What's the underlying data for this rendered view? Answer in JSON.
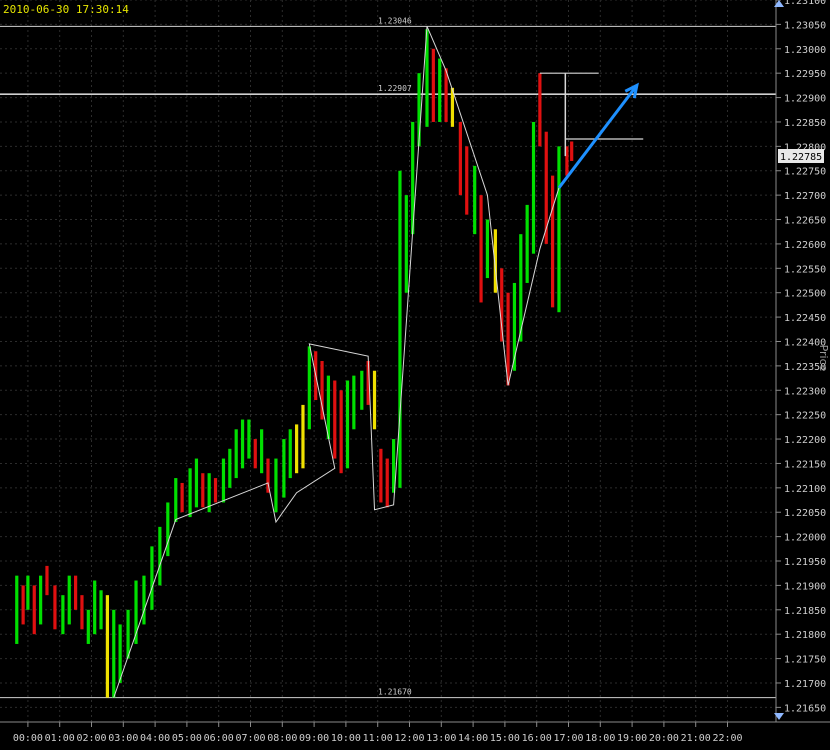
{
  "timestamp": "2010-06-30 17:30:14",
  "axis_title": "Price",
  "colors": {
    "background": "#000000",
    "grid": "#2c2c2c",
    "bar_up": "#00e000",
    "bar_down": "#e01010",
    "bar_neutral": "#f0e000",
    "zigzag": "#d8d8d8",
    "ref_line": "#d0d0d0",
    "arrow": "#1e90ff",
    "text": "#cfcfcf",
    "timestamp": "#e6e600"
  },
  "icons": {
    "scroll_up": "triangle-up-icon",
    "scroll_down": "triangle-down-icon"
  },
  "chart_data": {
    "type": "bar",
    "style": "ohlc-bars",
    "ylim": [
      1.2162,
      1.231
    ],
    "x_range": [
      0,
      23
    ],
    "grid": true,
    "y_ticks": [
      "1.23100",
      "1.23050",
      "1.23000",
      "1.22950",
      "1.22900",
      "1.22850",
      "1.22800",
      "1.22750",
      "1.22700",
      "1.22650",
      "1.22600",
      "1.22550",
      "1.22500",
      "1.22450",
      "1.22400",
      "1.22350",
      "1.22300",
      "1.22250",
      "1.22200",
      "1.22150",
      "1.22100",
      "1.22050",
      "1.22000",
      "1.21950",
      "1.21900",
      "1.21850",
      "1.21800",
      "1.21750",
      "1.21700",
      "1.21650"
    ],
    "x_ticks": [
      "00:00",
      "01:00",
      "02:00",
      "03:00",
      "04:00",
      "05:00",
      "06:00",
      "07:00",
      "08:00",
      "09:00",
      "10:00",
      "11:00",
      "12:00",
      "13:00",
      "14:00",
      "15:00",
      "16:00",
      "17:00",
      "18:00",
      "19:00",
      "20:00",
      "21:00",
      "22:00"
    ],
    "current_price": "1.22785",
    "reference_lines": [
      {
        "label": "1.23046",
        "value": 1.23046
      },
      {
        "label": "1.22907",
        "value": 1.22907
      },
      {
        "label": "1.21670",
        "value": 1.2167
      }
    ],
    "bars": [
      {
        "t": 0.0,
        "h": 1.2192,
        "l": 1.2178,
        "c": "g"
      },
      {
        "t": 0.2,
        "h": 1.219,
        "l": 1.2182,
        "c": "r"
      },
      {
        "t": 0.35,
        "h": 1.2192,
        "l": 1.2185,
        "c": "g"
      },
      {
        "t": 0.55,
        "h": 1.219,
        "l": 1.218,
        "c": "r"
      },
      {
        "t": 0.75,
        "h": 1.2192,
        "l": 1.2182,
        "c": "g"
      },
      {
        "t": 0.95,
        "h": 1.2194,
        "l": 1.2188,
        "c": "r"
      },
      {
        "t": 1.2,
        "h": 1.219,
        "l": 1.2181,
        "c": "r"
      },
      {
        "t": 1.45,
        "h": 1.2188,
        "l": 1.218,
        "c": "g"
      },
      {
        "t": 1.65,
        "h": 1.2192,
        "l": 1.2182,
        "c": "g"
      },
      {
        "t": 1.85,
        "h": 1.2192,
        "l": 1.2185,
        "c": "r"
      },
      {
        "t": 2.05,
        "h": 1.2188,
        "l": 1.2181,
        "c": "r"
      },
      {
        "t": 2.25,
        "h": 1.2185,
        "l": 1.2178,
        "c": "g"
      },
      {
        "t": 2.45,
        "h": 1.2191,
        "l": 1.218,
        "c": "g"
      },
      {
        "t": 2.65,
        "h": 1.2189,
        "l": 1.2181,
        "c": "g"
      },
      {
        "t": 2.85,
        "h": 1.2188,
        "l": 1.2167,
        "c": "y"
      },
      {
        "t": 3.05,
        "h": 1.2185,
        "l": 1.2167,
        "c": "g"
      },
      {
        "t": 3.25,
        "h": 1.2182,
        "l": 1.217,
        "c": "g"
      },
      {
        "t": 3.5,
        "h": 1.2185,
        "l": 1.2175,
        "c": "g"
      },
      {
        "t": 3.75,
        "h": 1.2191,
        "l": 1.2178,
        "c": "g"
      },
      {
        "t": 4.0,
        "h": 1.2192,
        "l": 1.2182,
        "c": "g"
      },
      {
        "t": 4.25,
        "h": 1.2198,
        "l": 1.2185,
        "c": "g"
      },
      {
        "t": 4.5,
        "h": 1.2202,
        "l": 1.219,
        "c": "g"
      },
      {
        "t": 4.75,
        "h": 1.2207,
        "l": 1.2196,
        "c": "g"
      },
      {
        "t": 5.0,
        "h": 1.2212,
        "l": 1.2203,
        "c": "g"
      },
      {
        "t": 5.2,
        "h": 1.2211,
        "l": 1.2205,
        "c": "r"
      },
      {
        "t": 5.45,
        "h": 1.2214,
        "l": 1.2204,
        "c": "g"
      },
      {
        "t": 5.65,
        "h": 1.2216,
        "l": 1.2206,
        "c": "g"
      },
      {
        "t": 5.85,
        "h": 1.2213,
        "l": 1.2206,
        "c": "r"
      },
      {
        "t": 6.05,
        "h": 1.2213,
        "l": 1.2205,
        "c": "g"
      },
      {
        "t": 6.25,
        "h": 1.2212,
        "l": 1.2207,
        "c": "r"
      },
      {
        "t": 6.5,
        "h": 1.2216,
        "l": 1.2207,
        "c": "g"
      },
      {
        "t": 6.7,
        "h": 1.2218,
        "l": 1.221,
        "c": "g"
      },
      {
        "t": 6.9,
        "h": 1.2222,
        "l": 1.2212,
        "c": "g"
      },
      {
        "t": 7.1,
        "h": 1.2224,
        "l": 1.2214,
        "c": "g"
      },
      {
        "t": 7.3,
        "h": 1.2224,
        "l": 1.2216,
        "c": "g"
      },
      {
        "t": 7.5,
        "h": 1.222,
        "l": 1.2214,
        "c": "r"
      },
      {
        "t": 7.7,
        "h": 1.2222,
        "l": 1.2213,
        "c": "g"
      },
      {
        "t": 7.9,
        "h": 1.2216,
        "l": 1.2209,
        "c": "r"
      },
      {
        "t": 8.15,
        "h": 1.2216,
        "l": 1.2205,
        "c": "g"
      },
      {
        "t": 8.4,
        "h": 1.222,
        "l": 1.2208,
        "c": "g"
      },
      {
        "t": 8.6,
        "h": 1.2222,
        "l": 1.2212,
        "c": "g"
      },
      {
        "t": 8.8,
        "h": 1.2223,
        "l": 1.2213,
        "c": "y"
      },
      {
        "t": 9.0,
        "h": 1.2227,
        "l": 1.2214,
        "c": "y"
      },
      {
        "t": 9.2,
        "h": 1.2239,
        "l": 1.2222,
        "c": "g"
      },
      {
        "t": 9.4,
        "h": 1.2238,
        "l": 1.2228,
        "c": "r"
      },
      {
        "t": 9.6,
        "h": 1.2236,
        "l": 1.2224,
        "c": "r"
      },
      {
        "t": 9.8,
        "h": 1.2233,
        "l": 1.222,
        "c": "g"
      },
      {
        "t": 10.0,
        "h": 1.2232,
        "l": 1.2216,
        "c": "r"
      },
      {
        "t": 10.2,
        "h": 1.223,
        "l": 1.2213,
        "c": "r"
      },
      {
        "t": 10.4,
        "h": 1.2232,
        "l": 1.2214,
        "c": "g"
      },
      {
        "t": 10.6,
        "h": 1.2233,
        "l": 1.2222,
        "c": "g"
      },
      {
        "t": 10.85,
        "h": 1.2234,
        "l": 1.2226,
        "c": "g"
      },
      {
        "t": 11.05,
        "h": 1.2236,
        "l": 1.2227,
        "c": "r"
      },
      {
        "t": 11.25,
        "h": 1.2234,
        "l": 1.2222,
        "c": "y"
      },
      {
        "t": 11.45,
        "h": 1.2218,
        "l": 1.2207,
        "c": "r"
      },
      {
        "t": 11.65,
        "h": 1.2216,
        "l": 1.2206,
        "c": "r"
      },
      {
        "t": 11.85,
        "h": 1.222,
        "l": 1.2209,
        "c": "g"
      },
      {
        "t": 12.05,
        "h": 1.2275,
        "l": 1.221,
        "c": "g"
      },
      {
        "t": 12.25,
        "h": 1.227,
        "l": 1.225,
        "c": "g"
      },
      {
        "t": 12.45,
        "h": 1.2285,
        "l": 1.2262,
        "c": "g"
      },
      {
        "t": 12.65,
        "h": 1.2295,
        "l": 1.228,
        "c": "g"
      },
      {
        "t": 12.9,
        "h": 1.2304,
        "l": 1.2284,
        "c": "g"
      },
      {
        "t": 13.1,
        "h": 1.23,
        "l": 1.2285,
        "c": "r"
      },
      {
        "t": 13.3,
        "h": 1.2298,
        "l": 1.2285,
        "c": "g"
      },
      {
        "t": 13.5,
        "h": 1.2296,
        "l": 1.2285,
        "c": "r"
      },
      {
        "t": 13.7,
        "h": 1.2292,
        "l": 1.2284,
        "c": "y"
      },
      {
        "t": 13.95,
        "h": 1.2285,
        "l": 1.227,
        "c": "r"
      },
      {
        "t": 14.15,
        "h": 1.228,
        "l": 1.2266,
        "c": "r"
      },
      {
        "t": 14.4,
        "h": 1.2276,
        "l": 1.2262,
        "c": "g"
      },
      {
        "t": 14.6,
        "h": 1.227,
        "l": 1.2248,
        "c": "r"
      },
      {
        "t": 14.8,
        "h": 1.2265,
        "l": 1.2253,
        "c": "g"
      },
      {
        "t": 15.05,
        "h": 1.2263,
        "l": 1.225,
        "c": "y"
      },
      {
        "t": 15.25,
        "h": 1.2255,
        "l": 1.224,
        "c": "r"
      },
      {
        "t": 15.45,
        "h": 1.225,
        "l": 1.2231,
        "c": "r"
      },
      {
        "t": 15.65,
        "h": 1.2252,
        "l": 1.2234,
        "c": "g"
      },
      {
        "t": 15.85,
        "h": 1.2262,
        "l": 1.224,
        "c": "g"
      },
      {
        "t": 16.05,
        "h": 1.2268,
        "l": 1.2252,
        "c": "g"
      },
      {
        "t": 16.25,
        "h": 1.2285,
        "l": 1.2258,
        "c": "g"
      },
      {
        "t": 16.45,
        "h": 1.2295,
        "l": 1.228,
        "c": "r"
      },
      {
        "t": 16.65,
        "h": 1.2283,
        "l": 1.226,
        "c": "r"
      },
      {
        "t": 16.85,
        "h": 1.2274,
        "l": 1.2247,
        "c": "r"
      },
      {
        "t": 17.05,
        "h": 1.228,
        "l": 1.2246,
        "c": "g"
      },
      {
        "t": 17.3,
        "h": 1.228,
        "l": 1.2274,
        "c": "r"
      },
      {
        "t": 17.45,
        "h": 1.2281,
        "l": 1.2277,
        "c": "r"
      }
    ],
    "zigzag": [
      {
        "t": 3.05,
        "v": 1.2167
      },
      {
        "t": 5.0,
        "v": 1.22035
      },
      {
        "t": 7.9,
        "v": 1.2211
      },
      {
        "t": 8.15,
        "v": 1.2203
      },
      {
        "t": 8.8,
        "v": 1.2209
      },
      {
        "t": 10.0,
        "v": 1.2214
      },
      {
        "t": 9.2,
        "v": 1.22395
      },
      {
        "t": 11.05,
        "v": 1.2237
      },
      {
        "t": 11.25,
        "v": 1.22055
      },
      {
        "t": 11.85,
        "v": 1.22065
      },
      {
        "t": 12.9,
        "v": 1.23046
      },
      {
        "t": 13.5,
        "v": 1.22955
      },
      {
        "t": 14.8,
        "v": 1.227
      },
      {
        "t": 15.45,
        "v": 1.2231
      },
      {
        "t": 16.45,
        "v": 1.2259
      },
      {
        "t": 17.05,
        "v": 1.22715
      }
    ],
    "level_marks": [
      {
        "t1": 16.45,
        "t2": 18.45,
        "v": 1.2295
      },
      {
        "t1": 17.25,
        "t2": 19.85,
        "v": 1.22815
      }
    ],
    "vertical_mark": {
      "t": 17.25,
      "v1": 1.2295,
      "v2": 1.2278
    },
    "arrow": {
      "t1": 17.05,
      "v1": 1.22715,
      "t2": 19.65,
      "v2": 1.22925
    }
  }
}
